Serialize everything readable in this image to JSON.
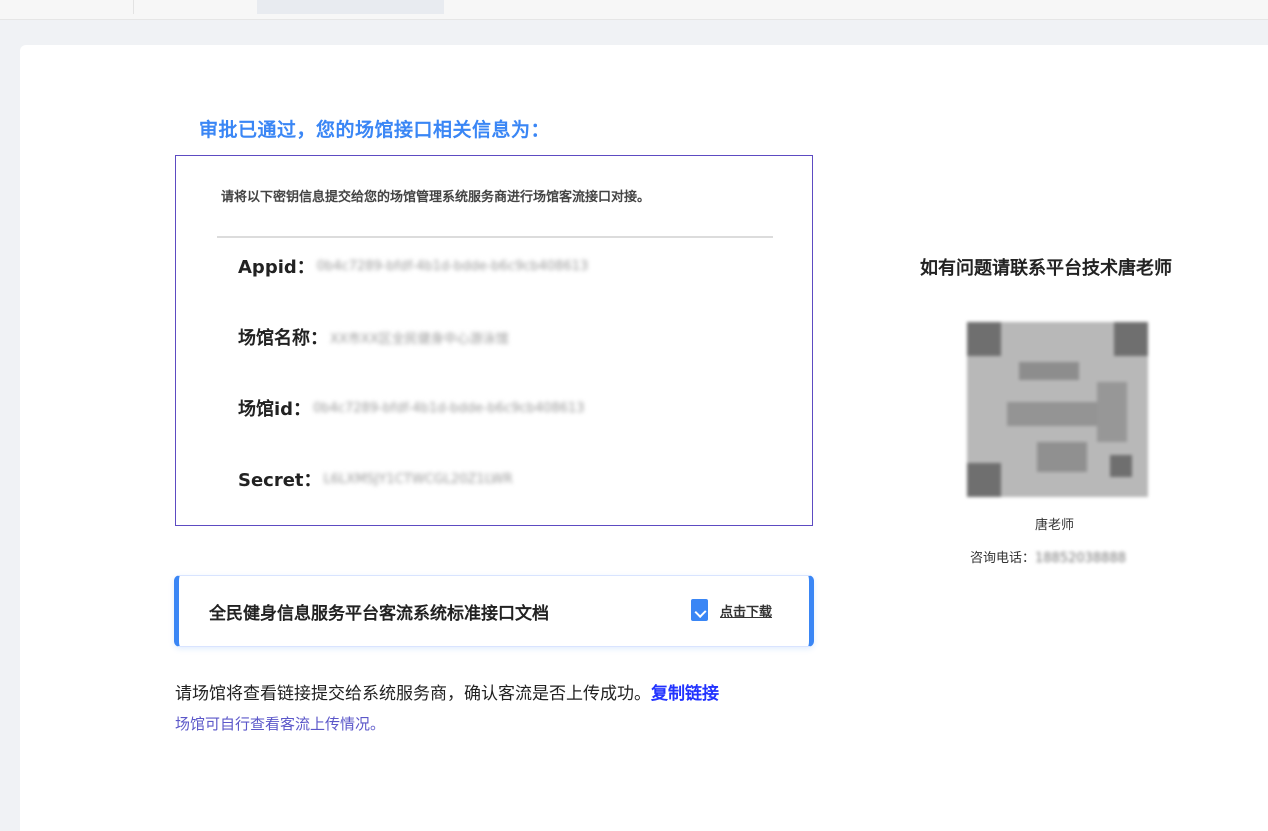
{
  "approval": {
    "title": "审批已通过，您的场馆接口相关信息为：",
    "notice": "请将以下密钥信息提交给您的场馆管理系统服务商进行场馆客流接口对接。",
    "fields": [
      {
        "label": "Appid：",
        "value": "0b4c7289-bfdf-4b1d-bdde-b6c9cb408613"
      },
      {
        "label": "场馆名称：",
        "value": "XX市XX区全民健身中心游泳馆"
      },
      {
        "label": "场馆id：",
        "value": "0b4c7289-bfdf-4b1d-bdde-b6c9cb408613"
      },
      {
        "label": "Secret：",
        "value": "L6LXMSJY1CTWCGL20Z1LWR"
      }
    ]
  },
  "document": {
    "title": "全民健身信息服务平台客流系统标准接口文档",
    "download_label": "点击下载"
  },
  "bottom": {
    "instruction": "请场馆将查看链接提交给系统服务商，确认客流是否上传成功。",
    "copy_link": "复制链接",
    "sub_note": "场馆可自行查看客流上传情况。"
  },
  "contact": {
    "title": "如有问题请联系平台技术唐老师",
    "name": "唐老师",
    "phone_label": "咨询电话：",
    "phone_value": "18852038888"
  },
  "colors": {
    "accent_blue": "#3a86f5",
    "box_border": "#5d4bc2",
    "link_blue": "#2233ff",
    "sub_note": "#5b57c9"
  }
}
